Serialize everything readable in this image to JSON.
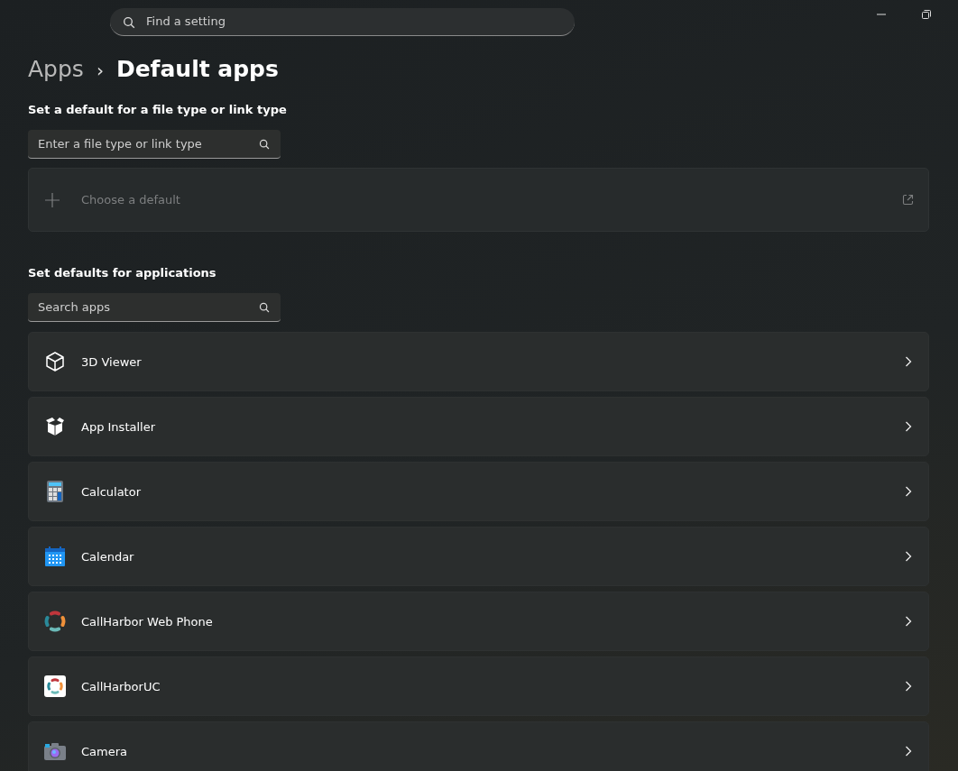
{
  "search": {
    "placeholder": "Find a setting"
  },
  "breadcrumb": {
    "parent": "Apps",
    "separator": "›",
    "current": "Default apps"
  },
  "file_type_section": {
    "heading": "Set a default for a file type or link type",
    "search": {
      "placeholder": "Enter a file type or link type"
    },
    "choose_default": {
      "label": "Choose a default",
      "disabled": true
    }
  },
  "apps_section": {
    "heading": "Set defaults for applications",
    "search": {
      "placeholder": "Search apps"
    },
    "apps": [
      {
        "name": "3D Viewer",
        "kind": "cube"
      },
      {
        "name": "App Installer",
        "kind": "package"
      },
      {
        "name": "Calculator",
        "kind": "calculator"
      },
      {
        "name": "Calendar",
        "kind": "calendar"
      },
      {
        "name": "CallHarbor Web Phone",
        "kind": "ring"
      },
      {
        "name": "CallHarborUC",
        "kind": "ring-tile"
      },
      {
        "name": "Camera",
        "kind": "camera"
      }
    ]
  }
}
